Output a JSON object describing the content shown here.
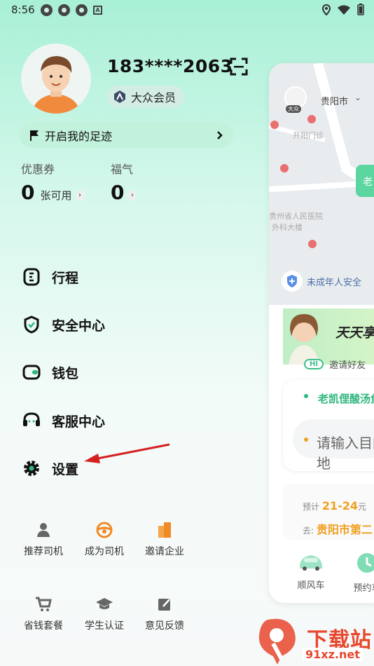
{
  "status_bar": {
    "time": "8:56",
    "notif_badge": "A"
  },
  "profile": {
    "phone": "183****2063",
    "member_label": "大众会员"
  },
  "footprint": {
    "label": "开启我的足迹"
  },
  "wallet": {
    "coupon_title": "优惠券",
    "coupon_value": "0",
    "coupon_unit": "张可用",
    "fuqi_title": "福气",
    "fuqi_value": "0"
  },
  "menu": [
    {
      "label": "行程",
      "icon": "trip-icon"
    },
    {
      "label": "安全中心",
      "icon": "shield-icon"
    },
    {
      "label": "钱包",
      "icon": "wallet-icon"
    },
    {
      "label": "客服中心",
      "icon": "headset-icon"
    },
    {
      "label": "设置",
      "icon": "gear-icon"
    }
  ],
  "grid": [
    {
      "label": "推荐司机",
      "icon": "driver-icon",
      "color": "#666666"
    },
    {
      "label": "成为司机",
      "icon": "steering-wheel-icon",
      "color": "#f08a24"
    },
    {
      "label": "邀请企业",
      "icon": "building-icon",
      "color": "#f08a24"
    },
    {
      "label": "省钱套餐",
      "icon": "cart-icon",
      "color": "#666666"
    },
    {
      "label": "学生认证",
      "icon": "graduation-cap-icon",
      "color": "#666666"
    },
    {
      "label": "意见反馈",
      "icon": "edit-icon",
      "color": "#666666"
    }
  ],
  "preview": {
    "city": "贵阳市",
    "mini_avatar_badge": "大众",
    "map_green_tag": "老",
    "safety_text": "未成年人安全",
    "banner_text": "天天享",
    "hi_badge": "HI",
    "invite_text": "邀请好友",
    "dest_place": "老凯俚酸汤鱼",
    "dest_placeholder": "请输入目的地",
    "trip_price_label": "预计",
    "trip_price": "21-24",
    "trip_price_unit": "元",
    "trip_to_label": "去:",
    "trip_to": "贵阳市第二",
    "nav": [
      {
        "label": "顺风车"
      },
      {
        "label": "预约车"
      }
    ],
    "map_labels": [
      "开阳门诊",
      "贵州省人民医院",
      "外科大楼"
    ]
  },
  "watermark": {
    "title": "下载站",
    "url": "91xz.net"
  },
  "colors": {
    "accent": "#2fb77e",
    "dark_icon": "#111111",
    "arrow": "#d42020"
  }
}
